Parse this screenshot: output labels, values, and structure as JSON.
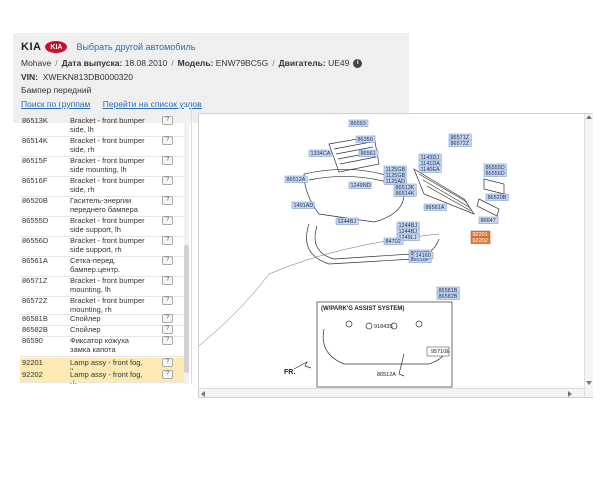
{
  "header": {
    "brand_text": "KIA",
    "logo_text": "KIA",
    "change_vehicle_link": "Выбрать другой автомобиль",
    "model_name": "Mohave",
    "release_label": "Дата выпуска:",
    "release_value": "18.08.2010",
    "model_label": "Модель:",
    "model_value": "ENW79BC5G",
    "engine_label": "Двигатель:",
    "engine_value": "UE49",
    "info_icon_glyph": "i",
    "vin_label": "VIN:",
    "vin_value": "XWEKN813DB0000320",
    "section_name": "Бампер передний",
    "brand_color": "#c8102e"
  },
  "nav": {
    "search_by_groups": "Поиск по группам",
    "to_parts_list": "Перейти на список узлов"
  },
  "parts": [
    {
      "num": "86513K",
      "name": "Bracket - front bumper side, lh",
      "highlight": false
    },
    {
      "num": "86514K",
      "name": "Bracket - front bumper side, rh",
      "highlight": false
    },
    {
      "num": "86515F",
      "name": "Bracket - front bumper side mounting, lh",
      "highlight": false
    },
    {
      "num": "86516F",
      "name": "Bracket - front bumper side, rh",
      "highlight": false
    },
    {
      "num": "86520B",
      "name": "Гаситель-энергии переднего бампера",
      "highlight": false
    },
    {
      "num": "86555D",
      "name": "Bracket - front bumper side support, lh",
      "highlight": false
    },
    {
      "num": "86556D",
      "name": "Bracket - front bumper side support, rh",
      "highlight": false
    },
    {
      "num": "86561A",
      "name": "Сетка-перед. бампер.центр.",
      "highlight": false
    },
    {
      "num": "86571Z",
      "name": "Bracket - front bumper mounting, lh",
      "highlight": false
    },
    {
      "num": "86572Z",
      "name": "Bracket - front bumper mounting, rh",
      "highlight": false
    },
    {
      "num": "86581B",
      "name": "Спойлер",
      "highlight": false
    },
    {
      "num": "86582B",
      "name": "Спойлер",
      "highlight": false
    },
    {
      "num": "86590",
      "name": "Фиксатор кожуха замка капота",
      "highlight": false
    },
    {
      "num": "92201",
      "name": "Lamp assy - front fog, lh",
      "highlight": true
    },
    {
      "num": "92202",
      "name": "Lamp assy - front fog, rh",
      "highlight": true
    }
  ],
  "part_button_glyph": "?",
  "diagram": {
    "labels": [
      "86593",
      "86350",
      "1334CA",
      "86561",
      "1125GB",
      "1125GB",
      "1125AD",
      "1249ND",
      "86513K",
      "86514K",
      "86512A",
      "1491AD",
      "1244BJ",
      "1244BJ",
      "1244BJ",
      "1249LJ",
      "84702",
      "86516F",
      "86518F",
      "14160",
      "86581B",
      "86582B",
      "86561A",
      "86571Z",
      "86572Z",
      "1143DJ",
      "1141DA",
      "1140EA",
      "86555D",
      "86556D",
      "86520B",
      "86647",
      "92201",
      "92202"
    ],
    "sub_title": "(W/PARK'G ASSIST SYSTEM)",
    "sub_labels": [
      "91843S",
      "95710E",
      "86512A"
    ],
    "fr_text": "FR.",
    "highlight_color": "#e07a3a"
  }
}
